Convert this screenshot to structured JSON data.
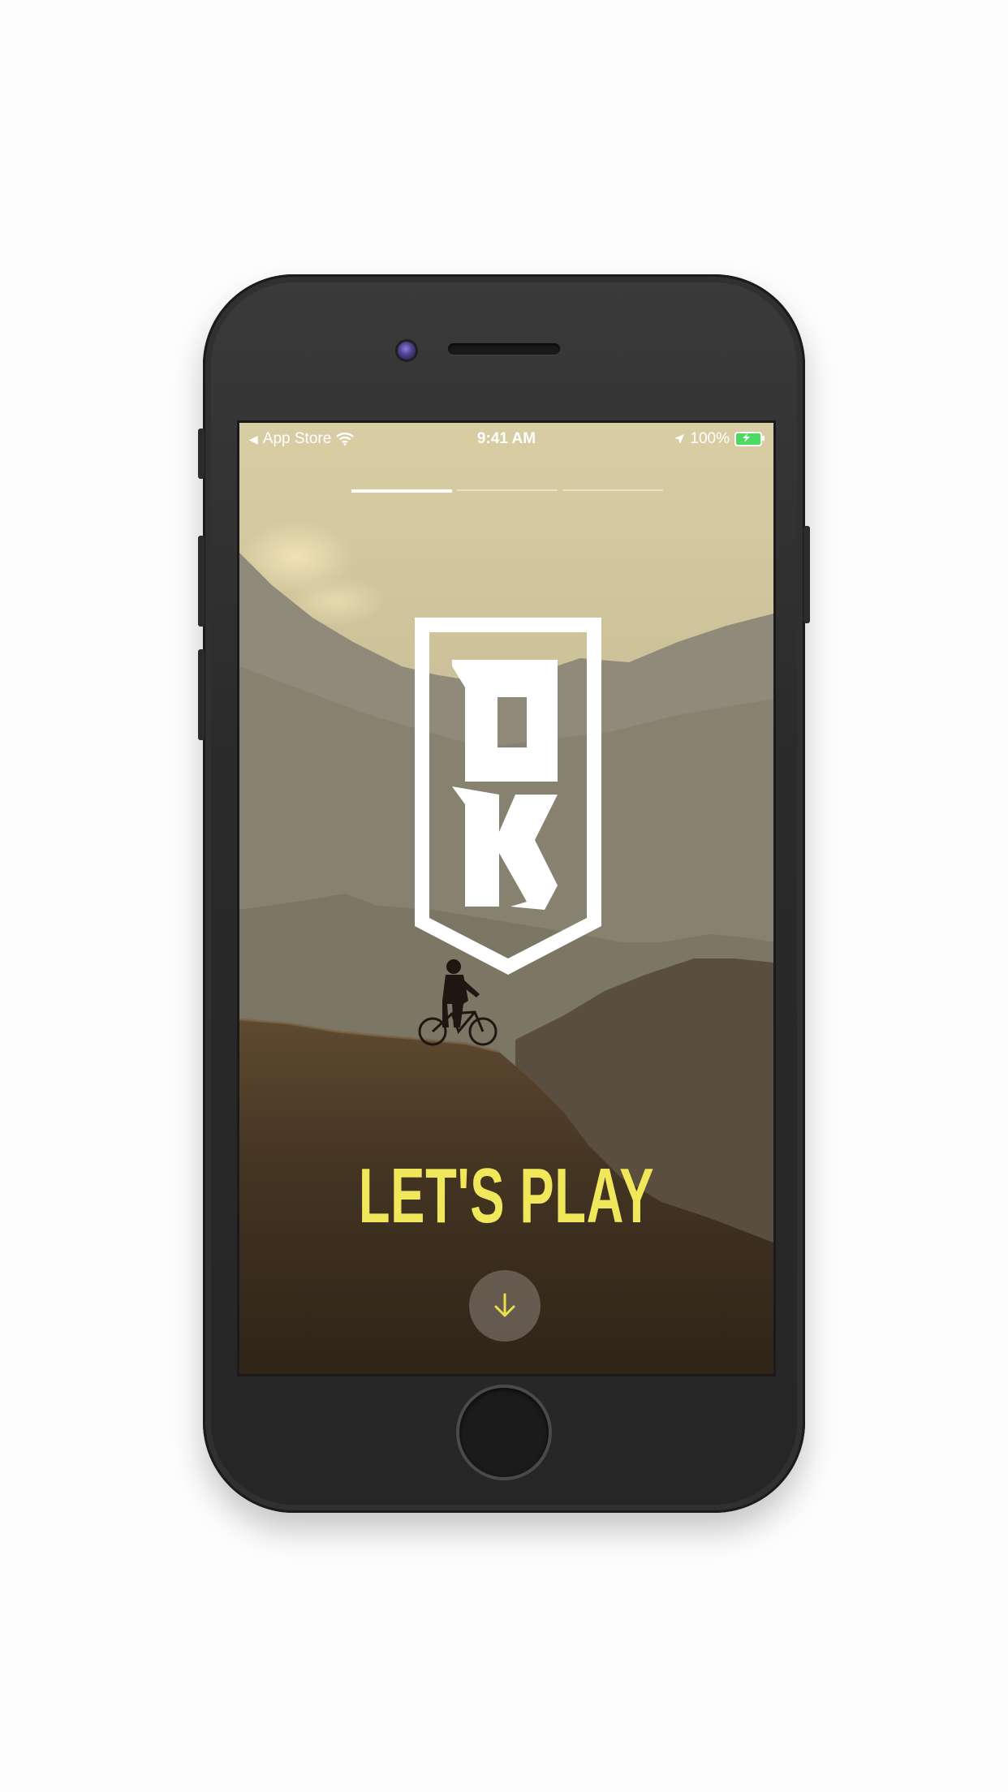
{
  "status_bar": {
    "back_app": "App Store",
    "time": "9:41 AM",
    "battery": "100%",
    "icons": [
      "back-arrow-icon",
      "wifi-icon",
      "location-arrow-icon",
      "battery-charging-icon"
    ]
  },
  "onboarding": {
    "progress_segments": 3,
    "active_segment": 1,
    "logo_icon": "bk-shield-logo-icon",
    "headline": "LET'S PLAY",
    "scroll_icon": "arrow-down-icon"
  },
  "colors": {
    "headline": "#f1e75a",
    "logo": "#ffffff",
    "battery": "#4cd964",
    "down_arrow": "#e9df4a"
  }
}
